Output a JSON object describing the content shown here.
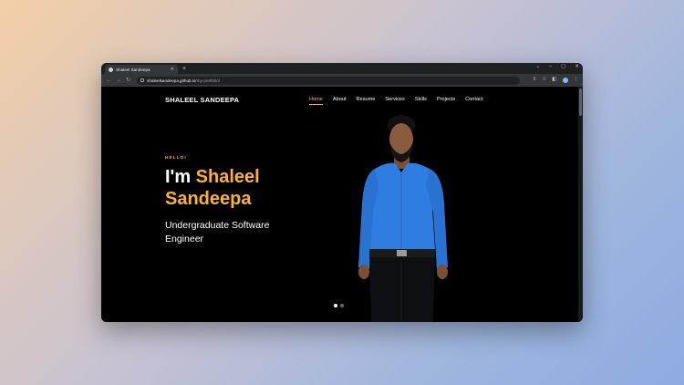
{
  "browser": {
    "tab_title": "Shaleel Sandeepa",
    "url_host": "shaleelsandeepa.github.io",
    "url_path": "/my-portfolio/"
  },
  "site": {
    "brand": "SHALEEL SANDEEPA",
    "nav": [
      "Home",
      "About",
      "Resume",
      "Services",
      "Skills",
      "Projects",
      "Contact"
    ],
    "active_nav": "Home",
    "accent_color": "#ffb02e"
  },
  "hero": {
    "kicker": "HELLO!",
    "heading_prefix": "I'm ",
    "heading_name_line1": "Shaleel",
    "heading_name_line2": "Sandeepa",
    "subtitle": "Undergraduate Software Engineer",
    "slides": 2,
    "active_slide": 1
  }
}
